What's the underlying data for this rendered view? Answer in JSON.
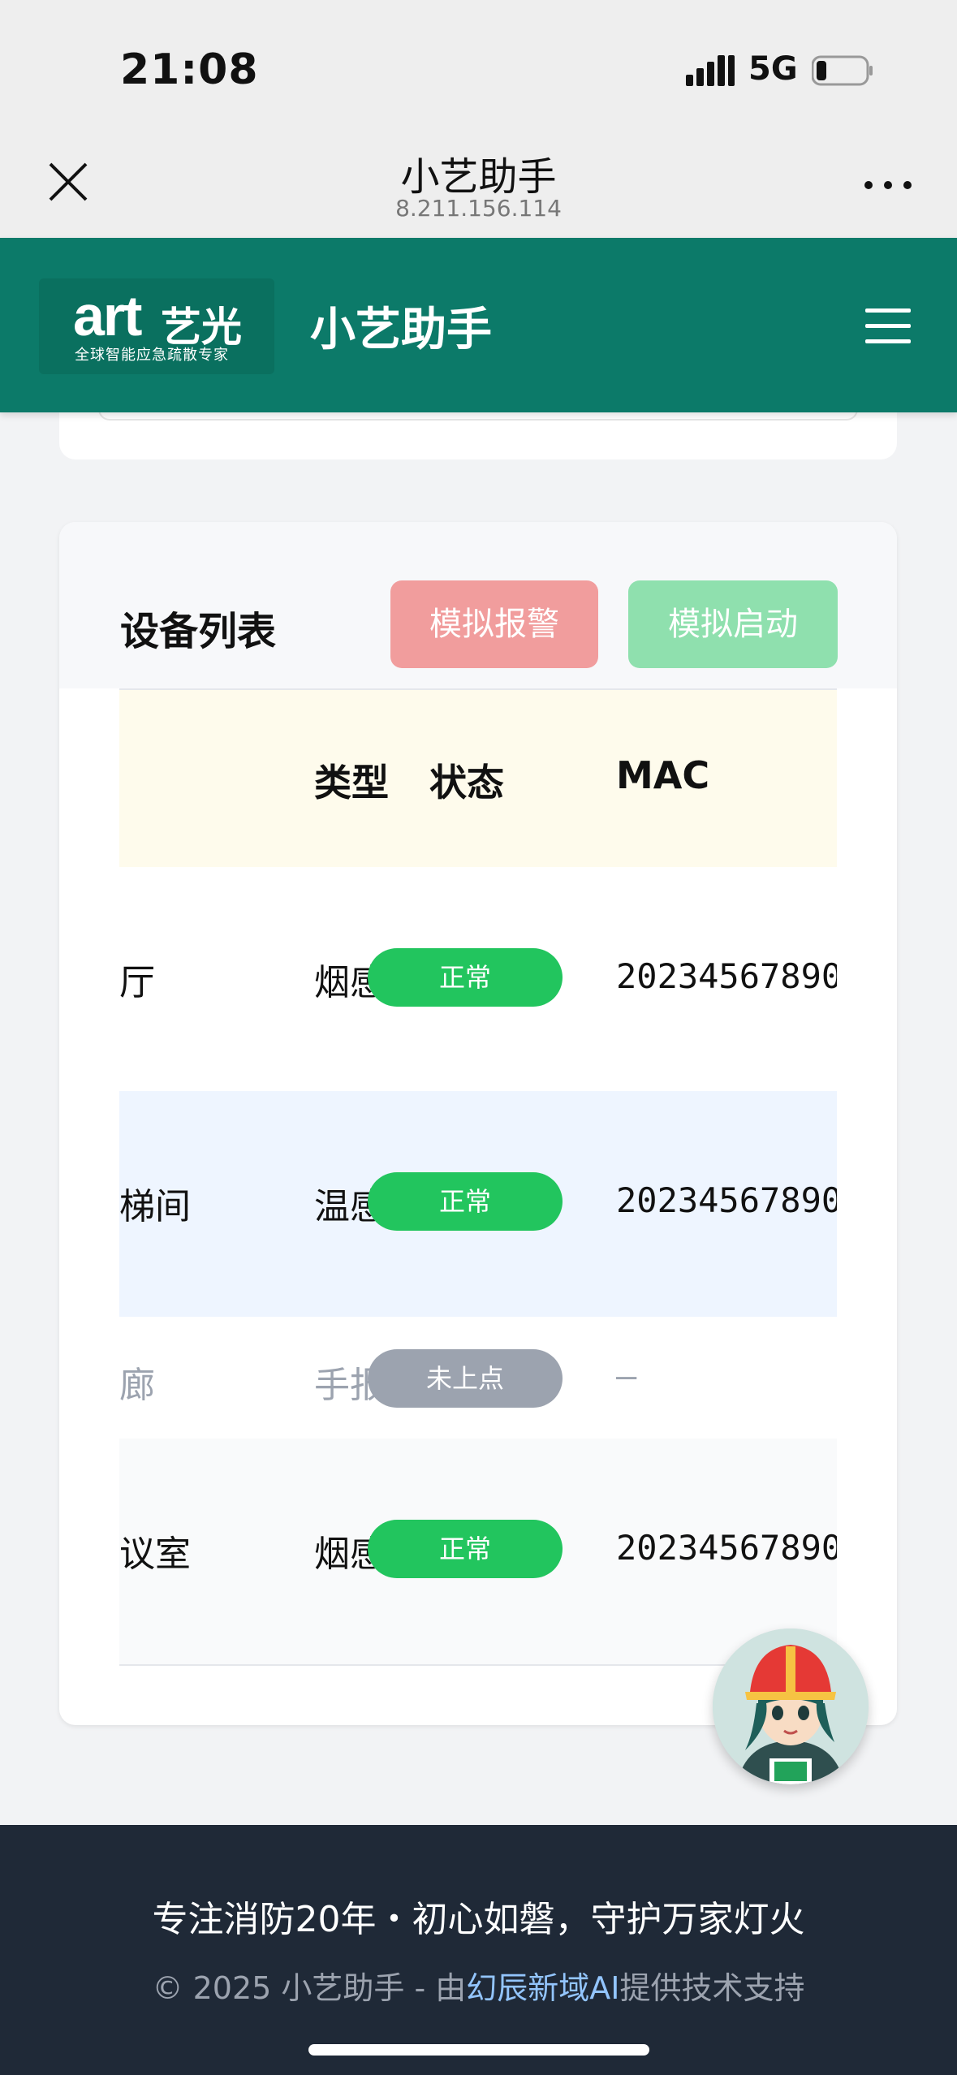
{
  "status_bar": {
    "time": "21:08",
    "network": "5G"
  },
  "browser": {
    "title": "小艺助手",
    "subtitle": "8.211.156.114"
  },
  "header": {
    "logo_text": "art",
    "logo_cn": "艺光",
    "logo_tagline": "全球智能应急疏散专家",
    "title": "小艺助手"
  },
  "device_card": {
    "title": "设备列表",
    "alarm_button": "模拟报警",
    "start_button": "模拟启动",
    "columns": [
      "类型",
      "状态",
      "MAC"
    ],
    "rows": [
      {
        "location": "厅",
        "type": "烟感",
        "status": "正常",
        "mac": "20234567890"
      },
      {
        "location": "梯间",
        "type": "温感",
        "status": "正常",
        "mac": "20234567890"
      },
      {
        "location": "廊",
        "type": "手报",
        "status": "未上点",
        "mac": "–"
      },
      {
        "location": "议室",
        "type": "烟感",
        "status": "正常",
        "mac": "20234567890"
      }
    ]
  },
  "footer": {
    "slogan": "专注消防20年・初心如磐，守护万家灯火",
    "copyright_prefix": "© 2025 小艺助手 - 由",
    "copyright_link": "幻辰新域AI",
    "copyright_suffix": "提供技术支持"
  },
  "colors": {
    "brand": "#0c7a69",
    "status_ok": "#22c55e",
    "status_off": "#9ca3af",
    "alarm": "#f19d9d",
    "start": "#8fe0ae",
    "footer_bg": "#1f2937"
  },
  "icons": [
    "close-icon",
    "more-icon",
    "menu-icon",
    "signal-icon",
    "battery-icon",
    "mascot-icon"
  ]
}
